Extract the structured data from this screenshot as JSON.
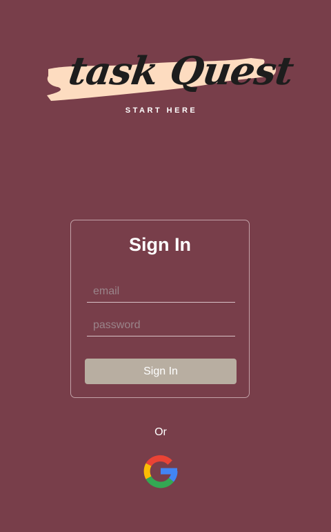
{
  "logo": {
    "title": "task Quest",
    "subtitle": "START HERE",
    "brush_color": "#fddcc0"
  },
  "signin": {
    "title": "Sign In",
    "email_placeholder": "email",
    "email_value": "",
    "password_placeholder": "password",
    "password_value": "",
    "button_label": "Sign In"
  },
  "alternate": {
    "or_label": "Or",
    "google_icon": "google-icon"
  },
  "colors": {
    "background": "#783e4a",
    "button": "#b8aea1",
    "card_border": "#c3a2a8",
    "google": [
      "#ea4335",
      "#fbbc05",
      "#34a853",
      "#4285f4"
    ]
  }
}
